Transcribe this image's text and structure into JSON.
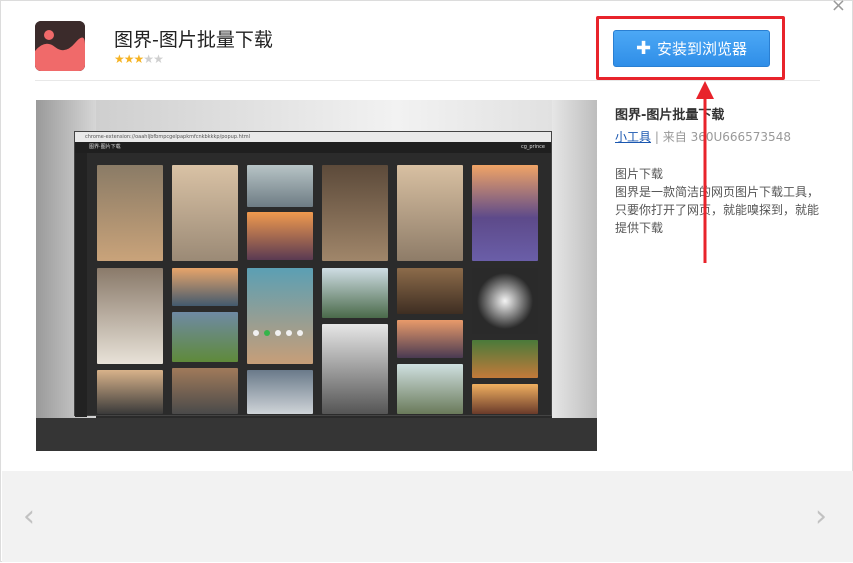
{
  "header": {
    "close_glyph": "×",
    "app_title": "图界-图片批量下载",
    "rating": 3,
    "rating_max": 5,
    "install_label": "安装到浏览器",
    "install_icon": "plus-icon"
  },
  "screenshot": {
    "window_title": "chrome-extension://oaahljbfbmpcgelpapkmfcnkbkkkp/popup.html",
    "app_name": "图界·图片下载",
    "user": "cg_prince",
    "slide_count": 5,
    "active_slide": 2
  },
  "details": {
    "title": "图界-图片批量下载",
    "author": "小工具",
    "separator": "|",
    "source_prefix": "来自",
    "source_id": "360U666573548",
    "desc_title": "图片下载",
    "desc": "图界是一款简洁的网页图片下载工具，只要你打开了网页，就能嗅探到，就能提供下载"
  },
  "nav": {
    "prev_glyph": "‹",
    "next_glyph": "›"
  },
  "colors": {
    "install": "#2f8ee8",
    "highlight": "#e8232b",
    "author_link": "#1a57b0",
    "star": "#f5b324"
  }
}
